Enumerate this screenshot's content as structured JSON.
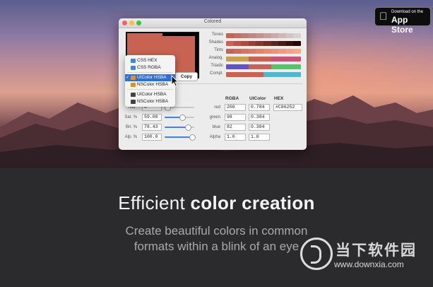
{
  "app_store": {
    "small": "Download on the",
    "big": "App Store"
  },
  "window": {
    "title": "Colored",
    "copy_label": "Copy",
    "rows": [
      {
        "label": "Tones",
        "colors": [
          "#c86252",
          "#c56e63",
          "#c37a72",
          "#c48680",
          "#c4928e",
          "#c69f9c",
          "#c9aba9",
          "#cdb8b6",
          "#d2c5c3",
          "#d7d1d0"
        ]
      },
      {
        "label": "Shades",
        "colors": [
          "#c86252",
          "#b65749",
          "#a44d40",
          "#924337",
          "#7f392f",
          "#6d2f27",
          "#5a251e",
          "#481b16",
          "#35110d",
          "#230806"
        ]
      },
      {
        "label": "Tints",
        "colors": [
          "#c86252",
          "#d06a58",
          "#d8725e",
          "#e07a64",
          "#e6826a",
          "#ec8a70",
          "#ef9276",
          "#f39a7c",
          "#f6a282",
          "#f8aa88"
        ]
      },
      {
        "label": "Analog.",
        "colors": [
          "#c8a052",
          "#c8a052",
          "#c8a052",
          "#c86252",
          "#c86252",
          "#c86252",
          "#c85276",
          "#c85276",
          "#c85276",
          "#c85276"
        ]
      },
      {
        "label": "Triadic",
        "colors": [
          "#6252c8",
          "#6252c8",
          "#6252c8",
          "#c86252",
          "#c86252",
          "#c86252",
          "#52c862",
          "#52c862",
          "#52c862",
          "#52c862"
        ]
      },
      {
        "label": "Compl.",
        "colors": [
          "#c86252",
          "#c86252",
          "#c86252",
          "#c86252",
          "#c86252",
          "#52b8c8",
          "#52b8c8",
          "#52b8c8",
          "#52b8c8",
          "#52b8c8"
        ]
      }
    ],
    "hsba": [
      {
        "label": "Hue°",
        "value": "8",
        "fill": 0.02
      },
      {
        "label": "Sat. %",
        "value": "59.00",
        "fill": 0.59
      },
      {
        "label": "Bri. %",
        "value": "78.43",
        "fill": 0.78
      },
      {
        "label": "Alp. %",
        "value": "100.0",
        "fill": 1.0
      }
    ],
    "headers": {
      "rgba": "RGBA",
      "uicolor": "UIColor",
      "hex": "HEX"
    },
    "channels": [
      {
        "label": "red",
        "rgba": "200",
        "uicolor": "0.784"
      },
      {
        "label": "green",
        "rgba": "98",
        "uicolor": "0.384"
      },
      {
        "label": "blue",
        "rgba": "82",
        "uicolor": "0.384"
      },
      {
        "label": "Alpha",
        "rgba": "1.0",
        "uicolor": "1.0"
      }
    ],
    "hex_value": "#C86252",
    "swatch_color": "#c86252"
  },
  "menu": {
    "items": [
      {
        "label": "CSS HEX",
        "icon_color": "#3f86e0",
        "selected": false
      },
      {
        "label": "CSS RGBA",
        "icon_color": "#3f86e0",
        "selected": false
      },
      {
        "label": "UIColor HSBA",
        "icon_color": "#f08a24",
        "selected": true,
        "check": "✓"
      },
      {
        "label": "NSColor HSBA",
        "icon_color": "#f08a24",
        "selected": false
      },
      {
        "label": "UIColor HSBA",
        "icon_color": "#444444",
        "selected": false
      },
      {
        "label": "NSColor HSBA",
        "icon_color": "#444444",
        "selected": false
      }
    ]
  },
  "headline": {
    "light": "Efficient ",
    "bold": "color creation"
  },
  "subline": {
    "line1": "Create beautiful colors in common",
    "line2": "formats within a blink of an eye"
  },
  "watermark": {
    "cn": "当下软件园",
    "url": "www.downxia.com"
  }
}
